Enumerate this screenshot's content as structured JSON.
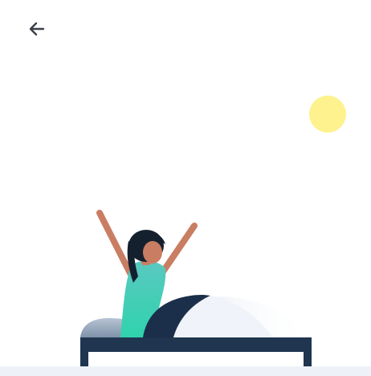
{
  "header": {
    "back_icon": "arrow-left-icon"
  },
  "illustration": {
    "subject": "wake-up-illustration",
    "colors": {
      "sun": "#fdf28d",
      "skin": "#c97d62",
      "hair": "#15202e",
      "shirt_top": "#5ac8c0",
      "shirt_bottom": "#2fd3ad",
      "blanket_dark": "#1b2f4a",
      "bed_frame": "#1f3550",
      "pillow": "#97a8bc",
      "glow": "#e6ecf6",
      "bottom_strip": "#eef2f8"
    }
  }
}
